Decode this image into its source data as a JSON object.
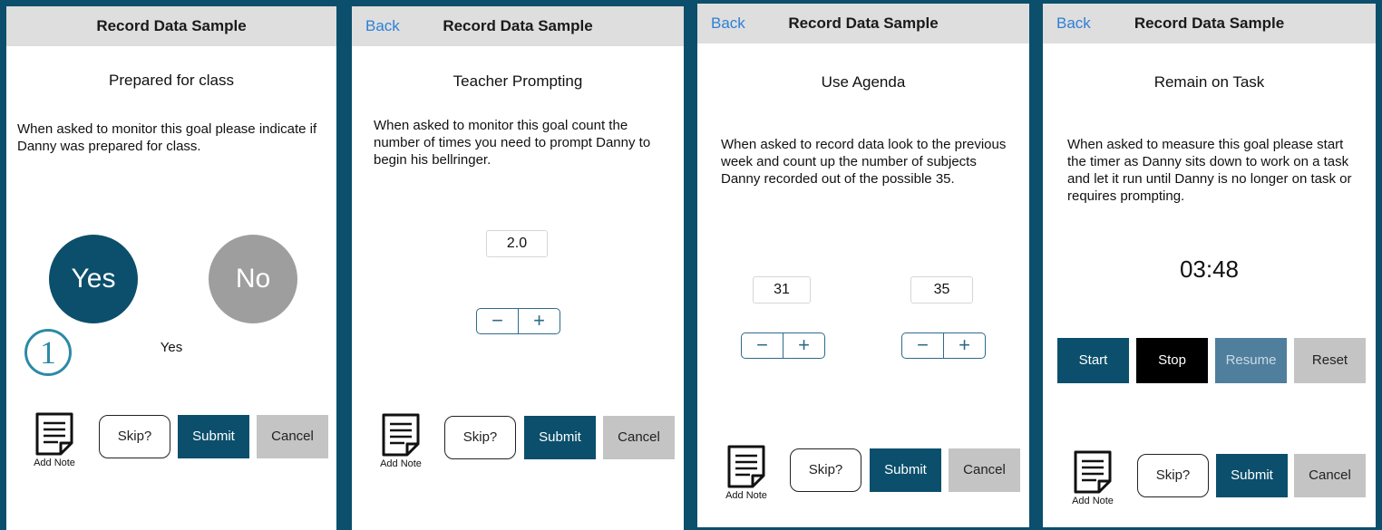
{
  "common": {
    "nav_title": "Record Data Sample",
    "back_label": "Back",
    "add_note_label": "Add Note",
    "skip_label": "Skip?",
    "submit_label": "Submit",
    "cancel_label": "Cancel",
    "minus": "−",
    "plus": "+"
  },
  "screen1": {
    "goal_title": "Prepared for class",
    "instructions": "When asked to monitor this goal please indicate if Danny was prepared for class.",
    "yes_label": "Yes",
    "no_label": "No",
    "selected_value": "Yes",
    "step_number": "1"
  },
  "screen2": {
    "goal_title": "Teacher Prompting",
    "instructions": "When asked to monitor this goal count the number of times you need to prompt Danny to begin his bellringer.",
    "count_value": "2.0"
  },
  "screen3": {
    "goal_title": "Use Agenda",
    "instructions": "When asked to record data look to the previous week and count up the number of subjects Danny recorded out of the possible 35.",
    "recorded_value": "31",
    "possible_value": "35"
  },
  "screen4": {
    "goal_title": "Remain on Task",
    "instructions": "When asked to measure this goal please start the timer as Danny sits down to work on a task and let it run until Danny is no longer on task or requires prompting.",
    "timer_value": "03:48",
    "start_label": "Start",
    "stop_label": "Stop",
    "resume_label": "Resume",
    "reset_label": "Reset"
  },
  "colors": {
    "background": "#0b4f6c",
    "primary": "#0b4f6c",
    "no_button": "#9e9e9e",
    "resume_button": "#4f7f9c",
    "stop_button": "#000000",
    "cancel_button": "#c4c4c4",
    "link": "#2e7fd6",
    "step_circle": "#2d8aa6"
  }
}
